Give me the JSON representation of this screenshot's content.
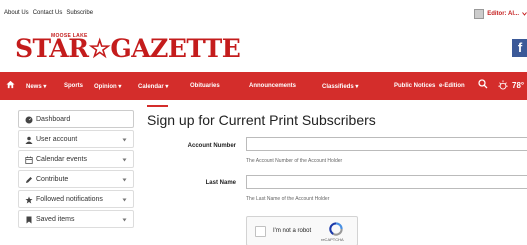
{
  "topbar": {
    "links": [
      "About Us",
      "Contact Us",
      "Subscribe"
    ],
    "user_label": "Editor: Al..."
  },
  "logo": {
    "top_text": "MOOSE LAKE",
    "main_text": "STAR☆GAZETTE"
  },
  "nav": {
    "items": [
      "News",
      "Sports",
      "Opinion",
      "Calendar",
      "Obituaries",
      "Announcements",
      "Classifieds",
      "Public Notices",
      "e-Edition"
    ],
    "temperature": "78°"
  },
  "sidebar": {
    "items": [
      {
        "label": "Dashboard",
        "icon": "dashboard-icon"
      },
      {
        "label": "User account",
        "icon": "user-icon"
      },
      {
        "label": "Calendar events",
        "icon": "calendar-icon"
      },
      {
        "label": "Contribute",
        "icon": "pencil-icon"
      },
      {
        "label": "Followed notifications",
        "icon": "star-icon"
      },
      {
        "label": "Saved items",
        "icon": "bookmark-icon"
      }
    ]
  },
  "main": {
    "title": "Sign up for Current Print Subscribers",
    "account_label": "Account Number",
    "account_help": "The Account Number of the Account Holder",
    "lastname_label": "Last Name",
    "lastname_help": "The Last Name of the Account Holder",
    "captcha_text": "I'm not a robot",
    "captcha_brand": "reCAPTCHA"
  },
  "colors": {
    "brand_red": "#d42d2b",
    "facebook_blue": "#3b5998"
  }
}
